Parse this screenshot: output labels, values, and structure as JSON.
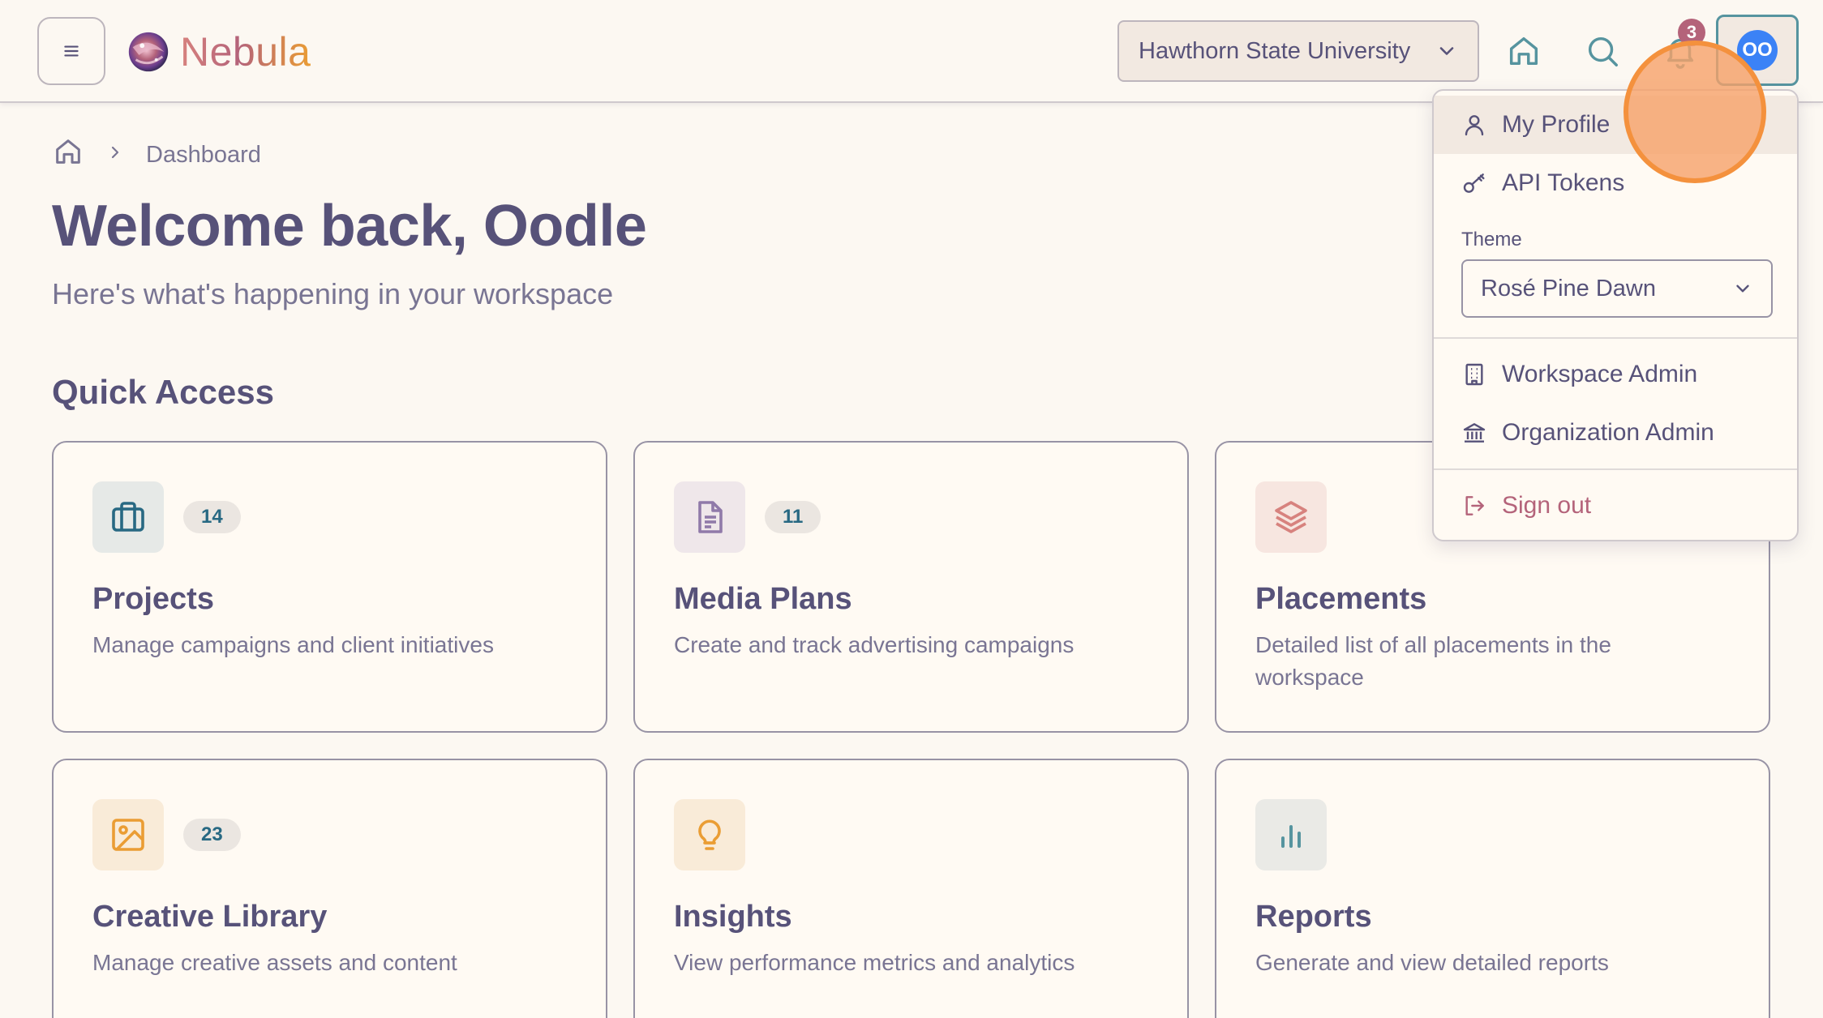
{
  "header": {
    "app_name": "Nebula",
    "workspace": "Hawthorn State University",
    "notification_count": "3",
    "avatar_initials": "OO"
  },
  "breadcrumb": {
    "current": "Dashboard"
  },
  "hero": {
    "title": "Welcome back, Oodle",
    "subtitle": "Here's what's happening in your workspace"
  },
  "quick_access": {
    "title": "Quick Access",
    "cards": [
      {
        "title": "Projects",
        "count": "14",
        "description": "Manage campaigns and client initiatives",
        "icon": "briefcase-icon",
        "icon_color": "#286983",
        "icon_bg": "#e6e9e7"
      },
      {
        "title": "Media Plans",
        "count": "11",
        "description": "Create and track advertising campaigns",
        "icon": "document-icon",
        "icon_color": "#907aa9",
        "icon_bg": "#efe7ea"
      },
      {
        "title": "Placements",
        "count": "",
        "description": "Detailed list of all placements in the workspace",
        "icon": "layers-icon",
        "icon_color": "#d7827e",
        "icon_bg": "#f7e6e0"
      },
      {
        "title": "Creative Library",
        "count": "23",
        "description": "Manage creative assets and content",
        "icon": "image-icon",
        "icon_color": "#ea9d34",
        "icon_bg": "#f9ebd8"
      },
      {
        "title": "Insights",
        "count": "",
        "description": "View performance metrics and analytics",
        "icon": "lightbulb-icon",
        "icon_color": "#ea9d34",
        "icon_bg": "#f9ebd8"
      },
      {
        "title": "Reports",
        "count": "",
        "description": "Generate and view detailed reports",
        "icon": "bar-chart-icon",
        "icon_color": "#56949f",
        "icon_bg": "#eaeae6"
      }
    ]
  },
  "user_menu": {
    "my_profile": "My Profile",
    "api_tokens": "API Tokens",
    "theme_label": "Theme",
    "theme_value": "Rosé Pine Dawn",
    "workspace_admin": "Workspace Admin",
    "organization_admin": "Organization Admin",
    "sign_out": "Sign out"
  },
  "colors": {
    "background": "#fcf8f2",
    "text": "#575279",
    "muted": "#797593",
    "accent_pine": "#286983",
    "love": "#b4637a",
    "avatar": "#3b82f6"
  }
}
